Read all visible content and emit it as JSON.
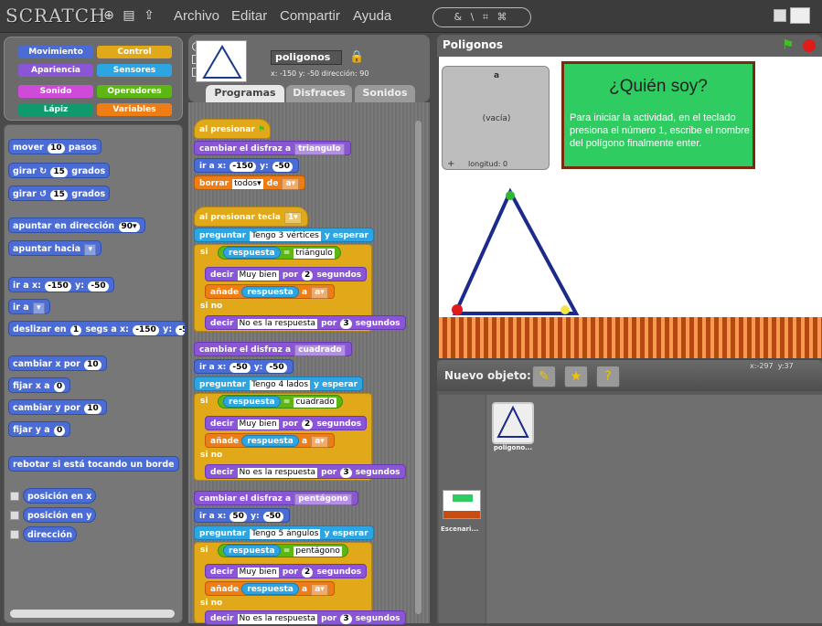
{
  "menubar": {
    "logo": "SCRATCH",
    "menus": [
      "Archivo",
      "Editar",
      "Compartir",
      "Ayuda"
    ],
    "tools_label": "& \\ ⌗ ⌘"
  },
  "categories": [
    {
      "label": "Movimiento",
      "color": "#4a6cd4"
    },
    {
      "label": "Control",
      "color": "#e1a91a"
    },
    {
      "label": "Apariencia",
      "color": "#8a55d7"
    },
    {
      "label": "Sensores",
      "color": "#2ca5e2"
    },
    {
      "label": "Sonido",
      "color": "#cf4ad9"
    },
    {
      "label": "Operadores",
      "color": "#5cb712"
    },
    {
      "label": "Lápiz",
      "color": "#0e9a6c"
    },
    {
      "label": "Variables",
      "color": "#ee7d16"
    }
  ],
  "palette": {
    "mover": {
      "pre": "mover",
      "n": "10",
      "post": "pasos"
    },
    "girar_r": {
      "pre": "girar ↻",
      "n": "15",
      "post": "grados"
    },
    "girar_l": {
      "pre": "girar ↺",
      "n": "15",
      "post": "grados"
    },
    "apuntar_dir": {
      "pre": "apuntar en dirección",
      "n": "90▾"
    },
    "apuntar_hacia": {
      "pre": "apuntar hacia"
    },
    "ir_xy": {
      "pre": "ir a x:",
      "x": "-150",
      "mid": "y:",
      "y": "-50"
    },
    "ir_a": {
      "pre": "ir a"
    },
    "deslizar": {
      "pre": "deslizar en",
      "n": "1",
      "mid": "segs a x:",
      "x": "-150",
      "mid2": "y:",
      "y": "-5"
    },
    "cambiar_x": {
      "pre": "cambiar x por",
      "n": "10"
    },
    "fijar_x": {
      "pre": "fijar x a",
      "n": "0"
    },
    "cambiar_y": {
      "pre": "cambiar y por",
      "n": "10"
    },
    "fijar_y": {
      "pre": "fijar y a",
      "n": "0"
    },
    "rebotar": {
      "pre": "rebotar si está tocando un borde"
    },
    "reporters": [
      "posición en x",
      "posición en y",
      "dirección"
    ]
  },
  "sprite": {
    "name": "poligonos",
    "coords": "x: -150  y: -50   dirección: 90"
  },
  "tabs": [
    "Programas",
    "Disfraces",
    "Sonidos"
  ],
  "scripts": {
    "hat1": "al presionar",
    "cambiar1": {
      "pre": "cambiar el disfraz a",
      "v": "triangulo"
    },
    "ira1": {
      "pre": "ir a x:",
      "x": "-150",
      "mid": "y:",
      "y": "-50"
    },
    "borrar": {
      "pre": "borrar",
      "v": "todos▾",
      "mid": "de",
      "v2": "a▾"
    },
    "hat2": {
      "pre": "al presionar tecla",
      "v": "1▾"
    },
    "preg1": {
      "pre": "preguntar",
      "v": "Tengo 3 vértices",
      "post": "y esperar"
    },
    "si1": {
      "pre": "si",
      "r": "respuesta",
      "eq": "=",
      "v": "triángulo"
    },
    "decir1": {
      "pre": "decir",
      "v": "Muy bien",
      "mid": "por",
      "n": "2",
      "post": "segundos"
    },
    "anade1": {
      "pre": "añade",
      "r": "respuesta",
      "mid": "a",
      "v": "a▾"
    },
    "sino1": "si no",
    "decirno1": {
      "pre": "decir",
      "v": "No es la respuesta",
      "mid": "por",
      "n": "3",
      "post": "segundos"
    },
    "cambiar2": {
      "pre": "cambiar el disfraz a",
      "v": "cuadrado"
    },
    "ira2": {
      "pre": "ir a x:",
      "x": "-50",
      "mid": "y:",
      "y": "-50"
    },
    "preg2": {
      "pre": "preguntar",
      "v": "Tengo 4 lados",
      "post": "y esperar"
    },
    "si2": {
      "pre": "si",
      "r": "respuesta",
      "eq": "=",
      "v": "cuadrado"
    },
    "decir2": {
      "pre": "decir",
      "v": "Muy bien",
      "mid": "por",
      "n": "2",
      "post": "segundos"
    },
    "anade2": {
      "pre": "añade",
      "r": "respuesta",
      "mid": "a",
      "v": "a▾"
    },
    "sino2": "si no",
    "decirno2": {
      "pre": "decir",
      "v": "No es la respuesta",
      "mid": "por",
      "n": "3",
      "post": "segundos"
    },
    "cambiar3": {
      "pre": "cambiar el disfraz a",
      "v": "pentágono"
    },
    "ira3": {
      "pre": "ir a x:",
      "x": "50",
      "mid": "y:",
      "y": "-50"
    },
    "preg3": {
      "pre": "preguntar",
      "v": "Tengo 5 ángulos",
      "post": "y esperar"
    },
    "si3": {
      "pre": "si",
      "r": "respuesta",
      "eq": "=",
      "v": "pentágono"
    },
    "decir3": {
      "pre": "decir",
      "v": "Muy bien",
      "mid": "por",
      "n": "2",
      "post": "segundos"
    },
    "anade3": {
      "pre": "añade",
      "r": "respuesta",
      "mid": "a",
      "v": "a▾"
    },
    "sino3": "si no",
    "decirno3": {
      "pre": "decir",
      "v": "No es la respuesta",
      "mid": "por",
      "n": "3",
      "post": "segundos"
    }
  },
  "stage": {
    "title": "Poligonos",
    "list_name": "a",
    "list_empty": "(vacía)",
    "list_length": "longitud: 0",
    "note_title": "¿Quién soy?",
    "note_text": "Para iniciar la actividad, en el teclado presiona el número 1, escribe el nombre del polígono finalmente enter.",
    "mouse_x_label": "x:",
    "mouse_x": "-297",
    "mouse_y_label": "y:",
    "mouse_y": "37"
  },
  "sprites": {
    "new_object_label": "Nuevo objeto:",
    "sprite_label": "poligono...",
    "stage_label": "Escenari..."
  }
}
